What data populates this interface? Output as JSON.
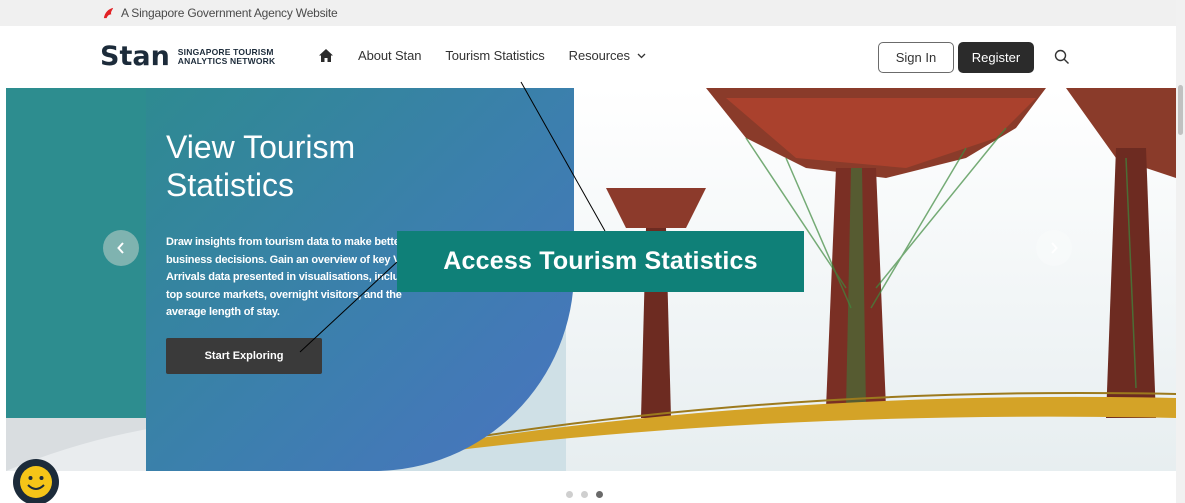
{
  "gov_bar": {
    "text": "A Singapore Government Agency Website",
    "icon": "lion-head-icon"
  },
  "header": {
    "logo_mark": "Stan",
    "logo_line1": "SINGAPORE TOURISM",
    "logo_line2": "ANALYTICS NETWORK",
    "nav": {
      "home_icon": "home-icon",
      "about": "About Stan",
      "stats": "Tourism Statistics",
      "resources": "Resources"
    },
    "sign_in": "Sign In",
    "register": "Register",
    "search_icon": "search-icon"
  },
  "hero": {
    "title": "View Tourism Statistics",
    "description": "Draw insights from tourism data to make better business decisions. Gain an overview of key Visitor Arrivals data presented in visualisations, including top source markets, overnight visitors, and the average length of stay.",
    "cta": "Start Exploring",
    "prev_icon": "chevron-left-icon",
    "next_icon": "chevron-right-icon"
  },
  "annotation": {
    "callout": "Access Tourism Statistics"
  },
  "carousel": {
    "slides": 3,
    "active": 3
  },
  "colors": {
    "teal": "#2d8d8f",
    "blue": "#4a73c0",
    "callout": "#0f8078",
    "dark": "#2b2b2b"
  }
}
